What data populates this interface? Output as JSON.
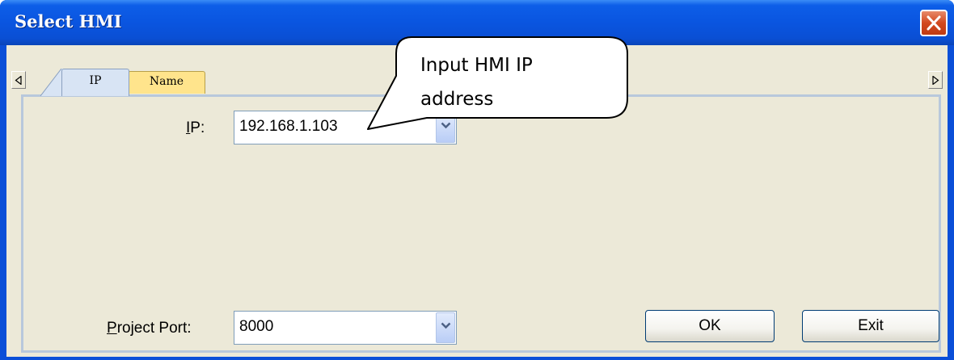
{
  "window": {
    "title": "Select HMI"
  },
  "tabs": [
    {
      "label": "IP",
      "active": true
    },
    {
      "label": "Name",
      "active": false
    }
  ],
  "ip_field": {
    "label_prefix": "",
    "label_mnemonic": "I",
    "label_rest": "P:",
    "value": "192.168.1.103"
  },
  "port_field": {
    "label_mnemonic": "P",
    "label_rest": "roject Port:",
    "value": "8000"
  },
  "buttons": {
    "ok": "OK",
    "exit": "Exit"
  },
  "callout": {
    "line1": "Input HMI IP",
    "line2": "address"
  },
  "colors": {
    "title_bar": "#0a4fd8",
    "dialog_bg": "#ece9d8",
    "name_tab": "#ffe48c",
    "ip_tab": "#d8e4f4",
    "close_button": "#d2491f"
  },
  "icons": {
    "close": "close-x-icon",
    "scroll_left": "triangle-left-icon",
    "scroll_right": "triangle-right-icon",
    "dropdown": "chevron-down-icon"
  }
}
